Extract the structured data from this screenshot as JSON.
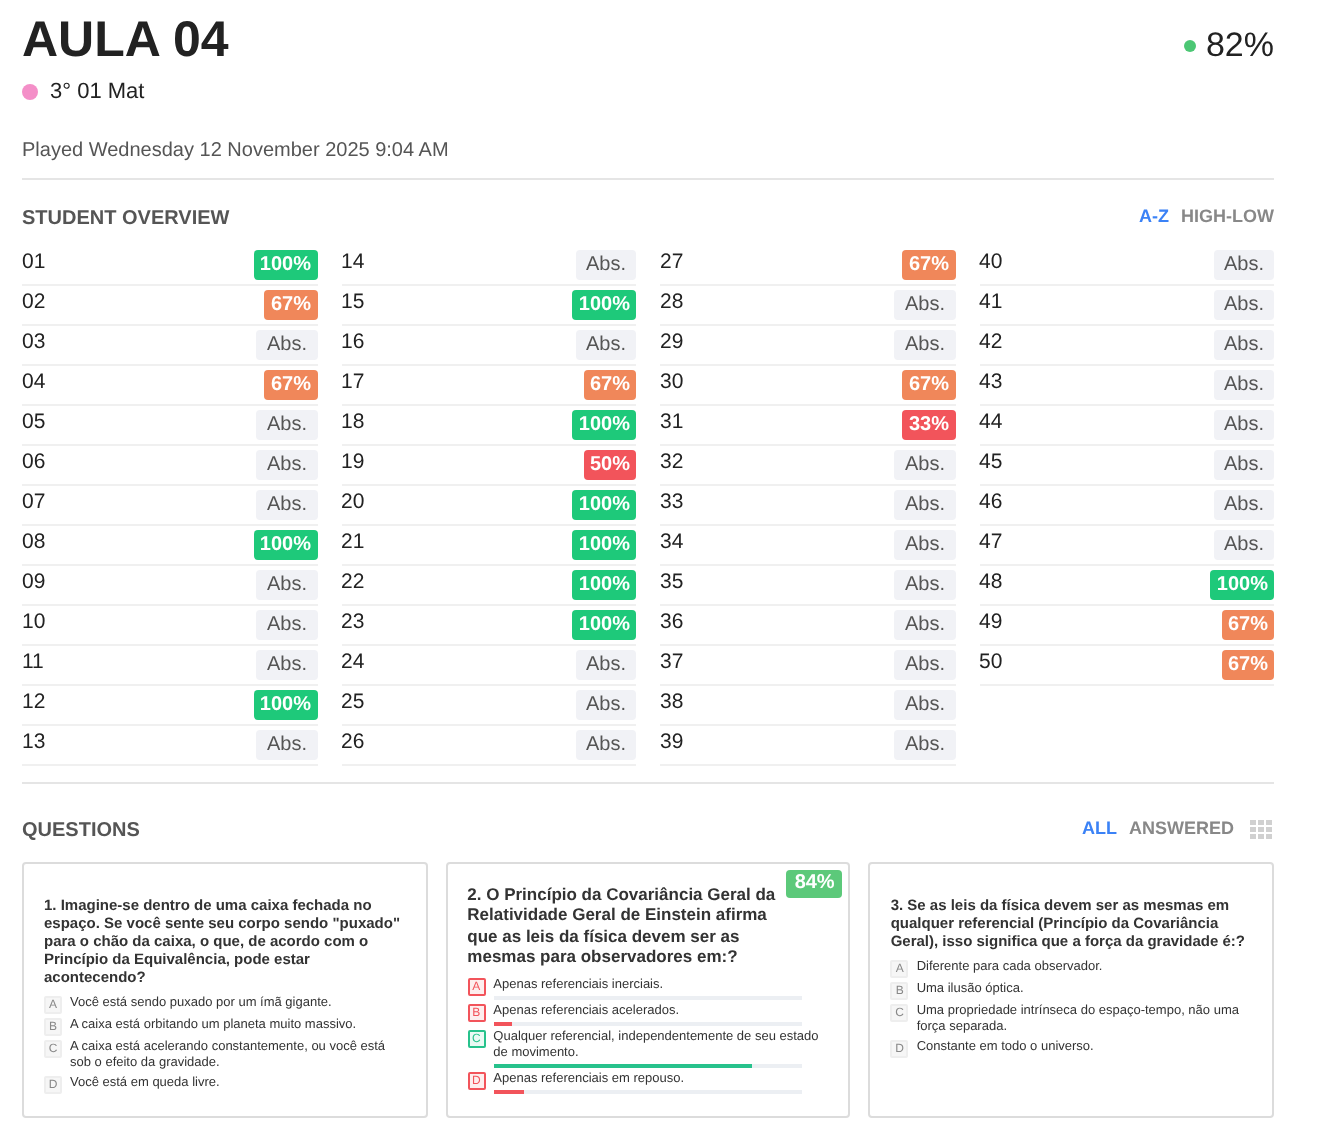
{
  "header": {
    "title": "AULA 04",
    "class_name": "3° 01 Mat",
    "score": "82%",
    "played": "Played Wednesday 12 November 2025 9:04 AM"
  },
  "overview": {
    "title": "STUDENT OVERVIEW",
    "sorts": [
      {
        "label": "A-Z",
        "selected": true
      },
      {
        "label": "HIGH-LOW",
        "selected": false
      }
    ],
    "students": [
      {
        "number": "01",
        "result": "100%",
        "kind": "score",
        "color": "#1ec97a"
      },
      {
        "number": "02",
        "result": "67%",
        "kind": "score",
        "color": "#f0875a"
      },
      {
        "number": "03",
        "result": "Abs.",
        "kind": "absent"
      },
      {
        "number": "04",
        "result": "67%",
        "kind": "score",
        "color": "#f0875a"
      },
      {
        "number": "05",
        "result": "Abs.",
        "kind": "absent"
      },
      {
        "number": "06",
        "result": "Abs.",
        "kind": "absent"
      },
      {
        "number": "07",
        "result": "Abs.",
        "kind": "absent"
      },
      {
        "number": "08",
        "result": "100%",
        "kind": "score",
        "color": "#1ec97a"
      },
      {
        "number": "09",
        "result": "Abs.",
        "kind": "absent"
      },
      {
        "number": "10",
        "result": "Abs.",
        "kind": "absent"
      },
      {
        "number": "11",
        "result": "Abs.",
        "kind": "absent"
      },
      {
        "number": "12",
        "result": "100%",
        "kind": "score",
        "color": "#1ec97a"
      },
      {
        "number": "13",
        "result": "Abs.",
        "kind": "absent"
      },
      {
        "number": "14",
        "result": "Abs.",
        "kind": "absent"
      },
      {
        "number": "15",
        "result": "100%",
        "kind": "score",
        "color": "#1ec97a"
      },
      {
        "number": "16",
        "result": "Abs.",
        "kind": "absent"
      },
      {
        "number": "17",
        "result": "67%",
        "kind": "score",
        "color": "#f0875a"
      },
      {
        "number": "18",
        "result": "100%",
        "kind": "score",
        "color": "#1ec97a"
      },
      {
        "number": "19",
        "result": "50%",
        "kind": "score",
        "color": "#f2545b"
      },
      {
        "number": "20",
        "result": "100%",
        "kind": "score",
        "color": "#1ec97a"
      },
      {
        "number": "21",
        "result": "100%",
        "kind": "score",
        "color": "#1ec97a"
      },
      {
        "number": "22",
        "result": "100%",
        "kind": "score",
        "color": "#1ec97a"
      },
      {
        "number": "23",
        "result": "100%",
        "kind": "score",
        "color": "#1ec97a"
      },
      {
        "number": "24",
        "result": "Abs.",
        "kind": "absent"
      },
      {
        "number": "25",
        "result": "Abs.",
        "kind": "absent"
      },
      {
        "number": "26",
        "result": "Abs.",
        "kind": "absent"
      },
      {
        "number": "27",
        "result": "67%",
        "kind": "score",
        "color": "#f0875a"
      },
      {
        "number": "28",
        "result": "Abs.",
        "kind": "absent"
      },
      {
        "number": "29",
        "result": "Abs.",
        "kind": "absent"
      },
      {
        "number": "30",
        "result": "67%",
        "kind": "score",
        "color": "#f0875a"
      },
      {
        "number": "31",
        "result": "33%",
        "kind": "score",
        "color": "#f2545b"
      },
      {
        "number": "32",
        "result": "Abs.",
        "kind": "absent"
      },
      {
        "number": "33",
        "result": "Abs.",
        "kind": "absent"
      },
      {
        "number": "34",
        "result": "Abs.",
        "kind": "absent"
      },
      {
        "number": "35",
        "result": "Abs.",
        "kind": "absent"
      },
      {
        "number": "36",
        "result": "Abs.",
        "kind": "absent"
      },
      {
        "number": "37",
        "result": "Abs.",
        "kind": "absent"
      },
      {
        "number": "38",
        "result": "Abs.",
        "kind": "absent"
      },
      {
        "number": "39",
        "result": "Abs.",
        "kind": "absent"
      },
      {
        "number": "40",
        "result": "Abs.",
        "kind": "absent"
      },
      {
        "number": "41",
        "result": "Abs.",
        "kind": "absent"
      },
      {
        "number": "42",
        "result": "Abs.",
        "kind": "absent"
      },
      {
        "number": "43",
        "result": "Abs.",
        "kind": "absent"
      },
      {
        "number": "44",
        "result": "Abs.",
        "kind": "absent"
      },
      {
        "number": "45",
        "result": "Abs.",
        "kind": "absent"
      },
      {
        "number": "46",
        "result": "Abs.",
        "kind": "absent"
      },
      {
        "number": "47",
        "result": "Abs.",
        "kind": "absent"
      },
      {
        "number": "48",
        "result": "100%",
        "kind": "score",
        "color": "#1ec97a"
      },
      {
        "number": "49",
        "result": "67%",
        "kind": "score",
        "color": "#f0875a"
      },
      {
        "number": "50",
        "result": "67%",
        "kind": "score",
        "color": "#f0875a"
      }
    ]
  },
  "questions": {
    "title": "QUESTIONS",
    "filters": [
      {
        "label": "ALL",
        "selected": true
      },
      {
        "label": "ANSWERED",
        "selected": false
      }
    ],
    "items": [
      {
        "kind": "plain",
        "text": "1. Imagine-se dentro de uma caixa fechada no espaço. Se você sente seu corpo sendo \"puxado\" para o chão da caixa, o que, de acordo com o Princípio da Equivalência, pode estar acontecendo?",
        "options": [
          {
            "letter": "A",
            "text": "Você está sendo puxado por um ímã gigante."
          },
          {
            "letter": "B",
            "text": "A caixa está orbitando um planeta muito massivo."
          },
          {
            "letter": "C",
            "text": "A caixa está acelerando constantemente, ou você está sob o efeito da gravidade."
          },
          {
            "letter": "D",
            "text": "Você está em queda livre."
          }
        ]
      },
      {
        "kind": "results",
        "score": "84%",
        "text": "2. O Princípio da Covariância Geral da Relatividade Geral de Einstein afirma que as leis da física devem ser as mesmas para observadores em:?",
        "options": [
          {
            "letter": "A",
            "text": "Apenas referenciais inerciais.",
            "correct": false
          },
          {
            "letter": "B",
            "text": "Apenas referenciais acelerados.",
            "correct": false,
            "level": 0.06
          },
          {
            "letter": "C",
            "text": "Qualquer referencial, independentemente de seu estado de movimento.",
            "correct": true,
            "level": 0.84
          },
          {
            "letter": "D",
            "text": "Apenas referenciais em repouso.",
            "correct": false,
            "level": 0.1
          }
        ]
      },
      {
        "kind": "plain",
        "text": "3. Se as leis da física devem ser as mesmas em qualquer referencial (Princípio da Covariância Geral), isso significa que a força da gravidade é:?",
        "options": [
          {
            "letter": "A",
            "text": "Diferente para cada observador."
          },
          {
            "letter": "B",
            "text": "Uma ilusão óptica."
          },
          {
            "letter": "C",
            "text": "Uma propriedade intrínseca do espaço-tempo, não uma força separada."
          },
          {
            "letter": "D",
            "text": "Constante em todo o universo."
          }
        ]
      }
    ]
  }
}
